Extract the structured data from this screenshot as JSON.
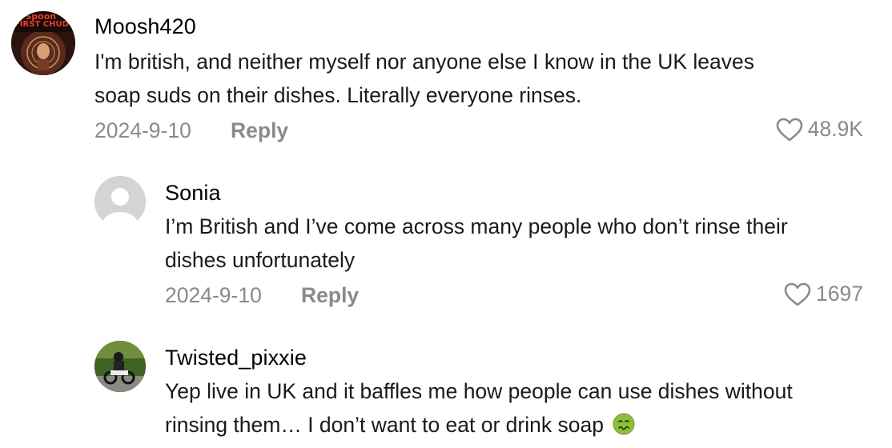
{
  "comments": [
    {
      "username": "Moosh420",
      "avatar_text_top": "ll Spoon",
      "avatar_text_bottom": "FIRST CHUD",
      "text_line1": "I'm british, and neither myself nor anyone else I know in the UK leaves",
      "text_line2": "soap suds on their dishes. Literally everyone rinses.",
      "date": "2024-9-10",
      "reply_label": "Reply",
      "likes": "48.9K"
    },
    {
      "username": "Sonia",
      "text_line1": "I’m British and I’ve come across many people who don’t rinse their",
      "text_line2": "dishes unfortunately",
      "date": "2024-9-10",
      "reply_label": "Reply",
      "likes": "1697"
    },
    {
      "username": "Twisted_pixxie",
      "text_line1": "Yep live in UK and it baffles me how people can use dishes without",
      "text_line2": "rinsing them… I don’t want to eat or drink soap",
      "emoji_icon": "nauseated-face-icon"
    }
  ],
  "colors": {
    "meta_gray": "#8a8a8a",
    "text": "#1a1a1a",
    "placeholder_avatar": "#d4d4d6"
  }
}
